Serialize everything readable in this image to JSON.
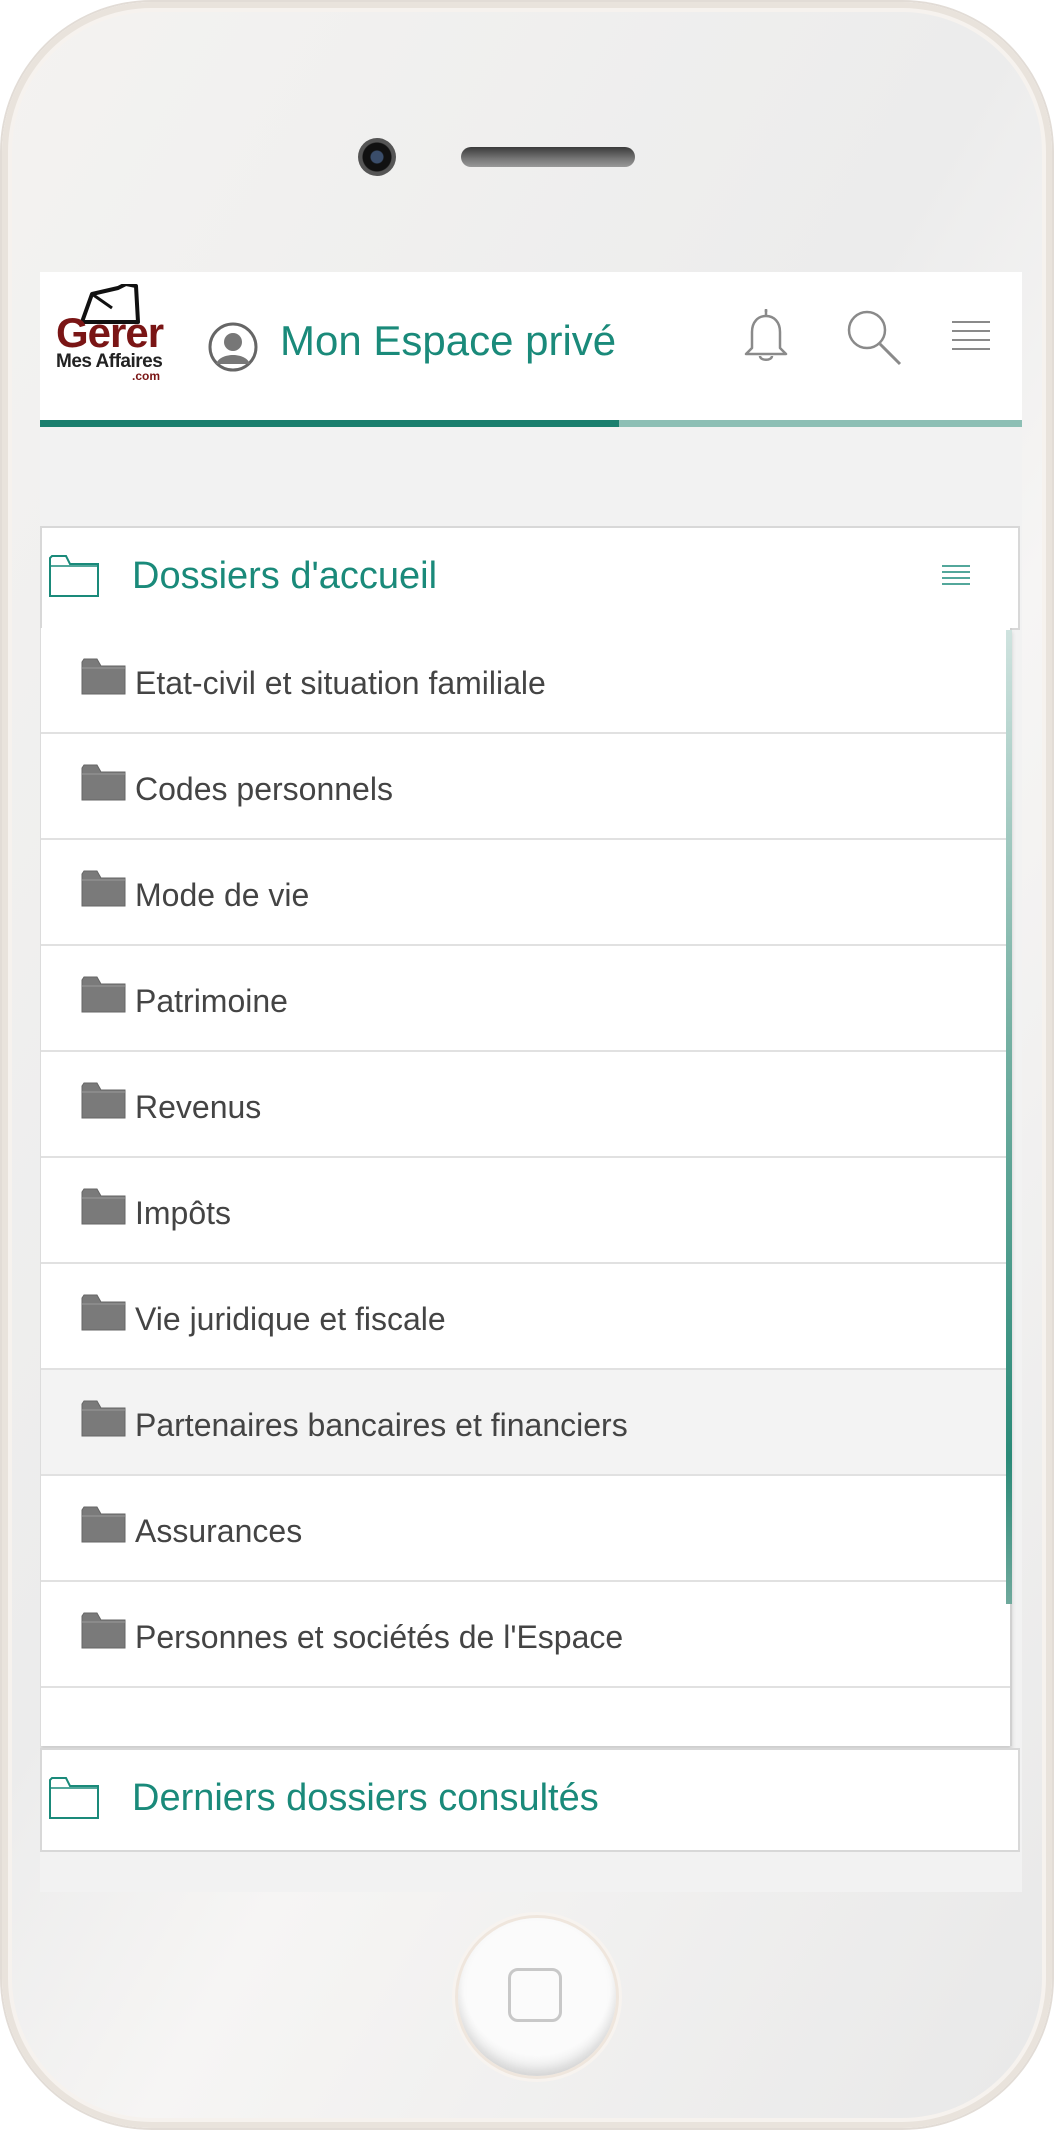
{
  "logo": {
    "line1": "Gerer",
    "line2": "Mes Affaires",
    "line3": ".com"
  },
  "header": {
    "title": "Mon Espace privé",
    "progress_fraction": 0.59
  },
  "icons": {
    "bell": "bell-icon",
    "search": "search-icon",
    "menu": "hamburger-menu-icon",
    "avatar": "user-avatar-icon",
    "folder": "folder-icon"
  },
  "colors": {
    "accent": "#1a8a7a",
    "brand": "#7a1515",
    "progress": "#1a7f6e"
  },
  "home_section": {
    "title": "Dossiers d'accueil",
    "items": [
      {
        "label": "Etat-civil et situation familiale"
      },
      {
        "label": "Codes personnels"
      },
      {
        "label": "Mode de vie"
      },
      {
        "label": "Patrimoine"
      },
      {
        "label": "Revenus"
      },
      {
        "label": "Impôts"
      },
      {
        "label": "Vie juridique et fiscale"
      },
      {
        "label": "Partenaires bancaires et financiers"
      },
      {
        "label": "Assurances"
      },
      {
        "label": "Personnes et sociétés de l'Espace"
      }
    ]
  },
  "recent_section": {
    "title": "Derniers dossiers consultés"
  }
}
